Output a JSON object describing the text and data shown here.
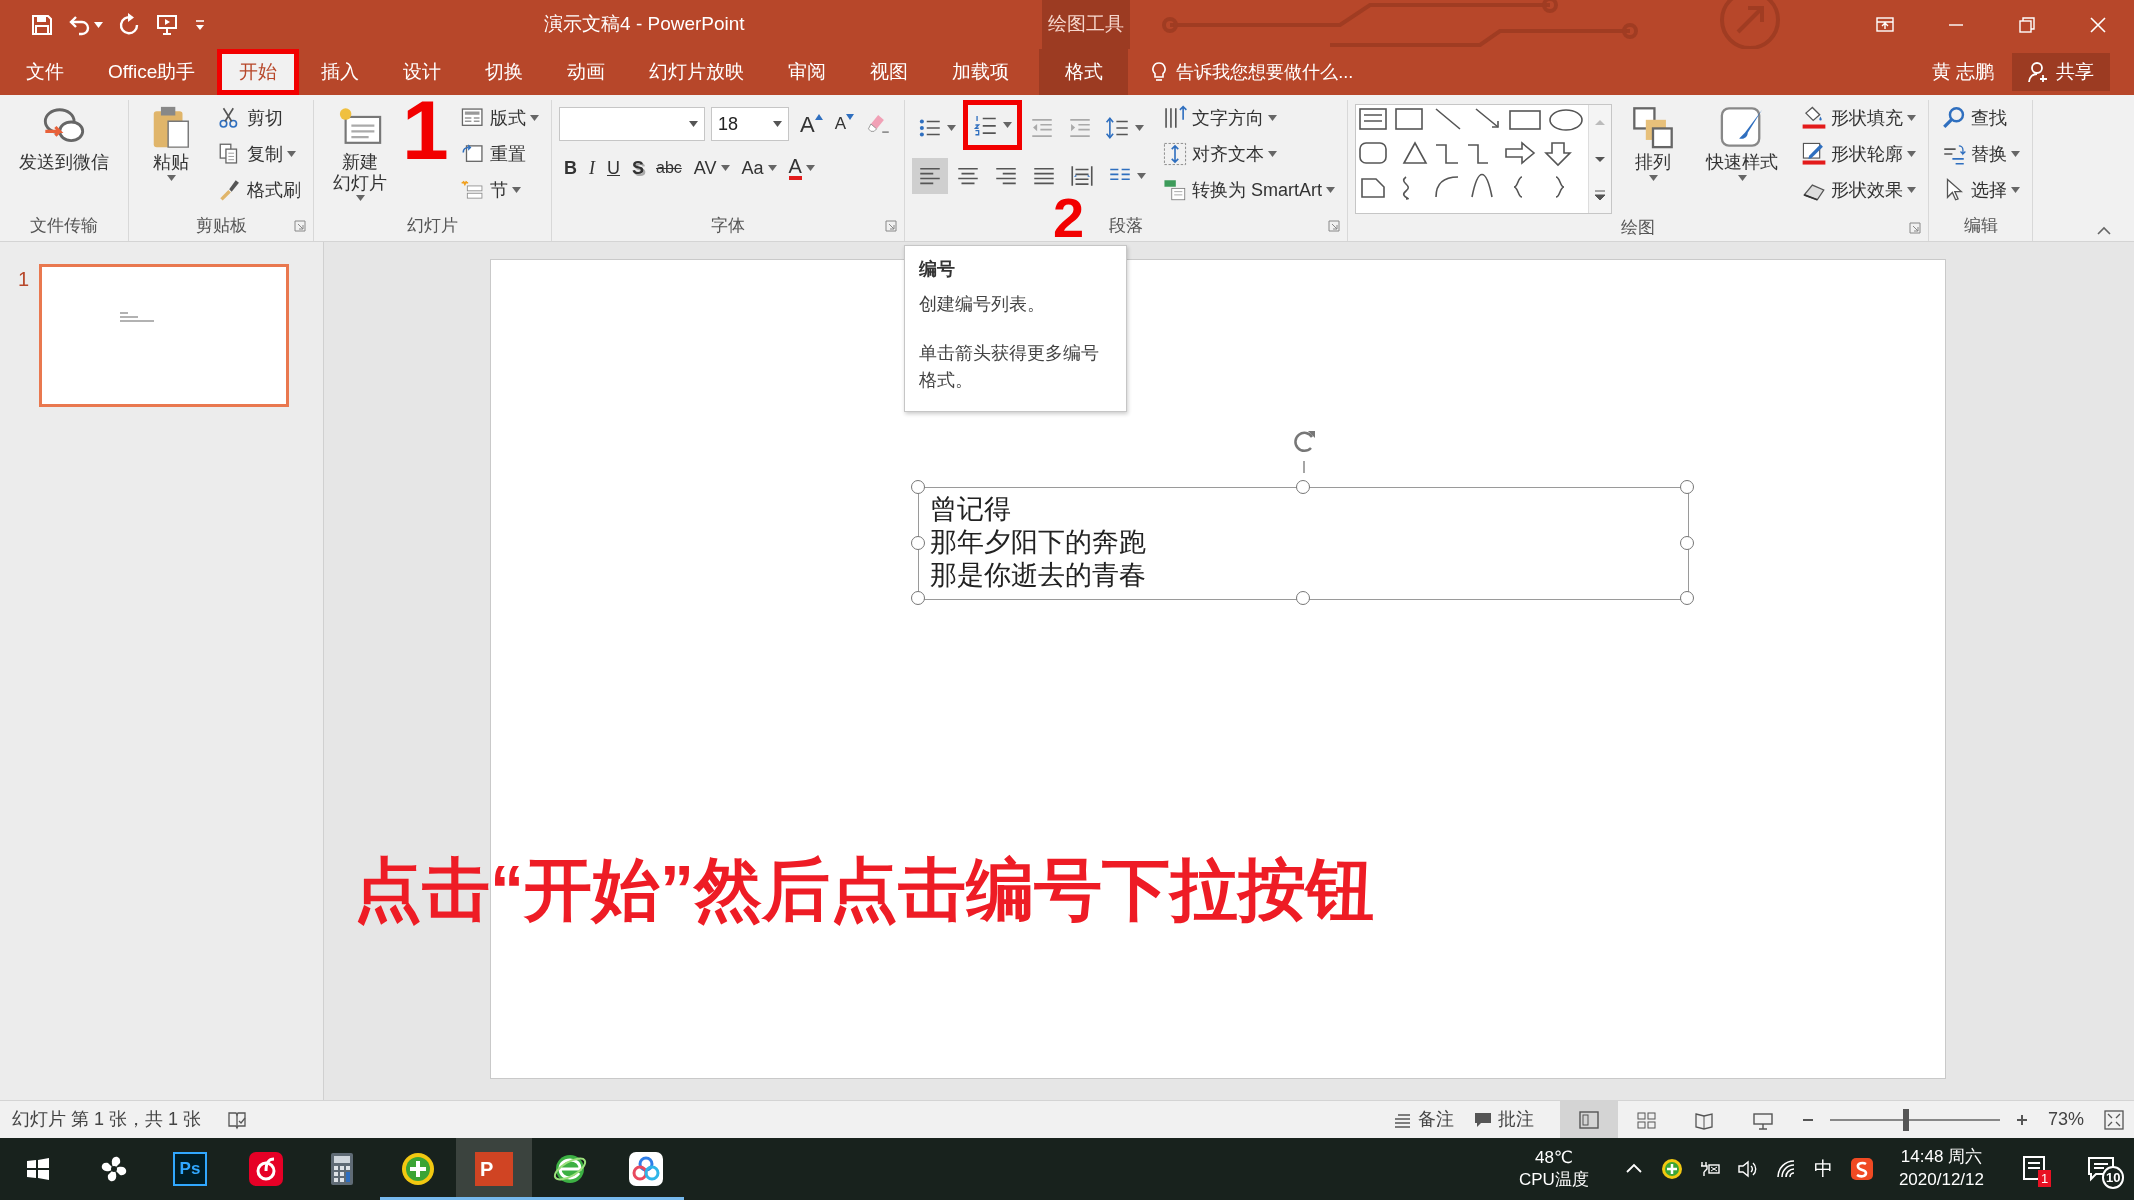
{
  "window": {
    "title": "演示文稿4 - PowerPoint",
    "context_group": "绘图工具"
  },
  "tabs": [
    {
      "label": "文件",
      "kind": "normal",
      "selected": false,
      "highlighted": false
    },
    {
      "label": "Office助手",
      "kind": "normal",
      "selected": false,
      "highlighted": false
    },
    {
      "label": "开始",
      "kind": "normal",
      "selected": true,
      "highlighted": true
    },
    {
      "label": "插入",
      "kind": "normal",
      "selected": false,
      "highlighted": false
    },
    {
      "label": "设计",
      "kind": "normal",
      "selected": false,
      "highlighted": false
    },
    {
      "label": "切换",
      "kind": "normal",
      "selected": false,
      "highlighted": false
    },
    {
      "label": "动画",
      "kind": "normal",
      "selected": false,
      "highlighted": false
    },
    {
      "label": "幻灯片放映",
      "kind": "normal",
      "selected": false,
      "highlighted": false
    },
    {
      "label": "审阅",
      "kind": "normal",
      "selected": false,
      "highlighted": false
    },
    {
      "label": "视图",
      "kind": "normal",
      "selected": false,
      "highlighted": false
    },
    {
      "label": "加载项",
      "kind": "normal",
      "selected": false,
      "highlighted": false
    },
    {
      "label": "格式",
      "kind": "contextual",
      "selected": false,
      "highlighted": false
    }
  ],
  "tell_me": "告诉我您想要做什么...",
  "user": "黄 志鹏",
  "share": "共享",
  "ribbon": [
    {
      "label": "文件传输",
      "launcher": false,
      "items": [
        {
          "kind": "large",
          "buttons": [
            {
              "kind": "wechat",
              "lines": [
                "发送到微信"
              ],
              "dropdown": false
            }
          ]
        }
      ]
    },
    {
      "label": "剪贴板",
      "launcher": true,
      "items": [
        {
          "kind": "large",
          "buttons": [
            {
              "kind": "paste",
              "lines": [
                "粘贴"
              ],
              "dropdown": true
            }
          ]
        },
        {
          "kind": "column",
          "buttons": [
            {
              "kind": "cut",
              "label": "剪切",
              "dropdown": false
            },
            {
              "kind": "copy",
              "label": "复制",
              "dropdown": true
            },
            {
              "kind": "format-painter",
              "label": "格式刷",
              "dropdown": false
            }
          ]
        }
      ]
    },
    {
      "label": "幻灯片",
      "launcher": false,
      "items": [
        {
          "kind": "large",
          "buttons": [
            {
              "kind": "new-slide",
              "lines": [
                "新建",
                "幻灯片"
              ],
              "dropdown": true
            }
          ]
        },
        {
          "kind": "column",
          "buttons": [
            {
              "kind": "layout",
              "label": "版式",
              "dropdown": true
            },
            {
              "kind": "reset",
              "label": "重置",
              "dropdown": false
            },
            {
              "kind": "section",
              "label": "节",
              "dropdown": true
            }
          ]
        }
      ]
    },
    {
      "label": "字体",
      "launcher": true,
      "items": [
        {
          "kind": "rows",
          "rows": [
            [
              {
                "kind": "font-name",
                "dropdown": true
              },
              {
                "kind": "font-size",
                "value": "18",
                "dropdown": true
              },
              {
                "kind": "grow-font",
                "label": "A",
                "dropdown": false
              },
              {
                "kind": "shrink-font",
                "label": "A",
                "dropdown": false
              },
              {
                "kind": "clear-format",
                "dropdown": false
              }
            ],
            [
              {
                "kind": "bold",
                "label": "B",
                "dropdown": false
              },
              {
                "kind": "italic",
                "label": "I",
                "dropdown": false
              },
              {
                "kind": "underline",
                "label": "U",
                "dropdown": false
              },
              {
                "kind": "shadow",
                "label": "S",
                "dropdown": false
              },
              {
                "kind": "strikethrough",
                "label": "abc",
                "dropdown": false
              },
              {
                "kind": "spacing",
                "label": "AV",
                "dropdown": true
              },
              {
                "kind": "change-case",
                "label": "Aa",
                "dropdown": true
              },
              {
                "kind": "font-color",
                "label": "A",
                "dropdown": true
              }
            ]
          ]
        }
      ]
    },
    {
      "label": "段落",
      "launcher": true,
      "items": [
        {
          "kind": "rows",
          "rows": [
            [
              {
                "kind": "bullets",
                "dropdown": true,
                "highlighted": false
              },
              {
                "kind": "numbering",
                "dropdown": true,
                "highlighted": true
              },
              {
                "kind": "outdent",
                "dropdown": false,
                "highlighted": false
              },
              {
                "kind": "indent",
                "dropdown": false,
                "highlighted": false
              },
              {
                "kind": "line-spacing",
                "dropdown": true,
                "highlighted": false
              }
            ],
            [
              {
                "kind": "align-left",
                "dropdown": false,
                "selected": true
              },
              {
                "kind": "align-center",
                "dropdown": false,
                "selected": false
              },
              {
                "kind": "align-right",
                "dropdown": false,
                "selected": false
              },
              {
                "kind": "justify",
                "dropdown": false,
                "selected": false
              },
              {
                "kind": "distribute",
                "dropdown": false,
                "selected": false
              },
              {
                "kind": "columns",
                "dropdown": true,
                "selected": false
              }
            ]
          ]
        },
        {
          "kind": "column",
          "buttons": [
            {
              "kind": "text-direction",
              "label": "文字方向",
              "dropdown": true
            },
            {
              "kind": "align-text",
              "label": "对齐文本",
              "dropdown": true
            },
            {
              "kind": "smartart",
              "label": "转换为 SmartArt",
              "dropdown": true
            }
          ]
        }
      ]
    },
    {
      "label": "绘图",
      "launcher": true,
      "items": [
        {
          "kind": "gallery"
        },
        {
          "kind": "large",
          "buttons": [
            {
              "kind": "arrange",
              "lines": [
                "排列"
              ],
              "dropdown": true
            }
          ]
        },
        {
          "kind": "large",
          "buttons": [
            {
              "kind": "quick-styles",
              "lines": [
                "快速样式"
              ],
              "dropdown": true
            }
          ]
        },
        {
          "kind": "column",
          "buttons": [
            {
              "kind": "shape-fill",
              "label": "形状填充",
              "dropdown": true
            },
            {
              "kind": "shape-outline",
              "label": "形状轮廓",
              "dropdown": true
            },
            {
              "kind": "shape-effects",
              "label": "形状效果",
              "dropdown": true
            }
          ]
        }
      ]
    },
    {
      "label": "编辑",
      "launcher": false,
      "items": [
        {
          "kind": "column",
          "buttons": [
            {
              "kind": "find",
              "label": "查找",
              "dropdown": false
            },
            {
              "kind": "replace",
              "label": "替换",
              "dropdown": true
            },
            {
              "kind": "select",
              "label": "选择",
              "dropdown": true
            }
          ]
        }
      ]
    }
  ],
  "tooltip": {
    "title": "编号",
    "lines": [
      "创建编号列表。",
      "单击箭头获得更多编号格式。"
    ]
  },
  "slides_panel": [
    {
      "number": "1",
      "selected": true
    }
  ],
  "slide": {
    "textbox": {
      "selected": true,
      "lines": [
        "曾记得",
        "那年夕阳下的奔跑",
        "那是你逝去的青春"
      ]
    }
  },
  "caption": "点击“开始”然后点击编号下拉按钮",
  "step_labels": [
    "1",
    "2"
  ],
  "status_bar": {
    "slide_info": "幻灯片 第 1 张，共 1 张",
    "notes": "备注",
    "comments": "批注",
    "views": [
      {
        "kind": "normal",
        "selected": true
      },
      {
        "kind": "sorter",
        "selected": false
      },
      {
        "kind": "reading",
        "selected": false
      },
      {
        "kind": "slideshow",
        "selected": false
      }
    ],
    "zoom": {
      "level": 0.45,
      "reading": "73%"
    }
  },
  "taskbar": {
    "apps": [
      {
        "kind": "pinwheel",
        "running": false,
        "selected": false
      },
      {
        "kind": "photoshop",
        "label": "Ps",
        "running": false,
        "selected": false
      },
      {
        "kind": "music",
        "running": false,
        "selected": false
      },
      {
        "kind": "calculator",
        "running": false,
        "selected": false
      },
      {
        "kind": "guard",
        "running": true,
        "selected": false
      },
      {
        "kind": "powerpoint",
        "label": "P",
        "running": true,
        "selected": true
      },
      {
        "kind": "browser",
        "running": true,
        "selected": false
      },
      {
        "kind": "cloud",
        "running": true,
        "selected": false
      }
    ],
    "cpu": {
      "temp": "48℃",
      "label": "CPU温度"
    },
    "ime": "中",
    "clock": {
      "time": "14:48 周六",
      "date": "2020/12/12"
    },
    "notifications": [
      {
        "kind": "message",
        "badge": "1"
      },
      {
        "kind": "action-center",
        "badge": "10"
      }
    ]
  }
}
